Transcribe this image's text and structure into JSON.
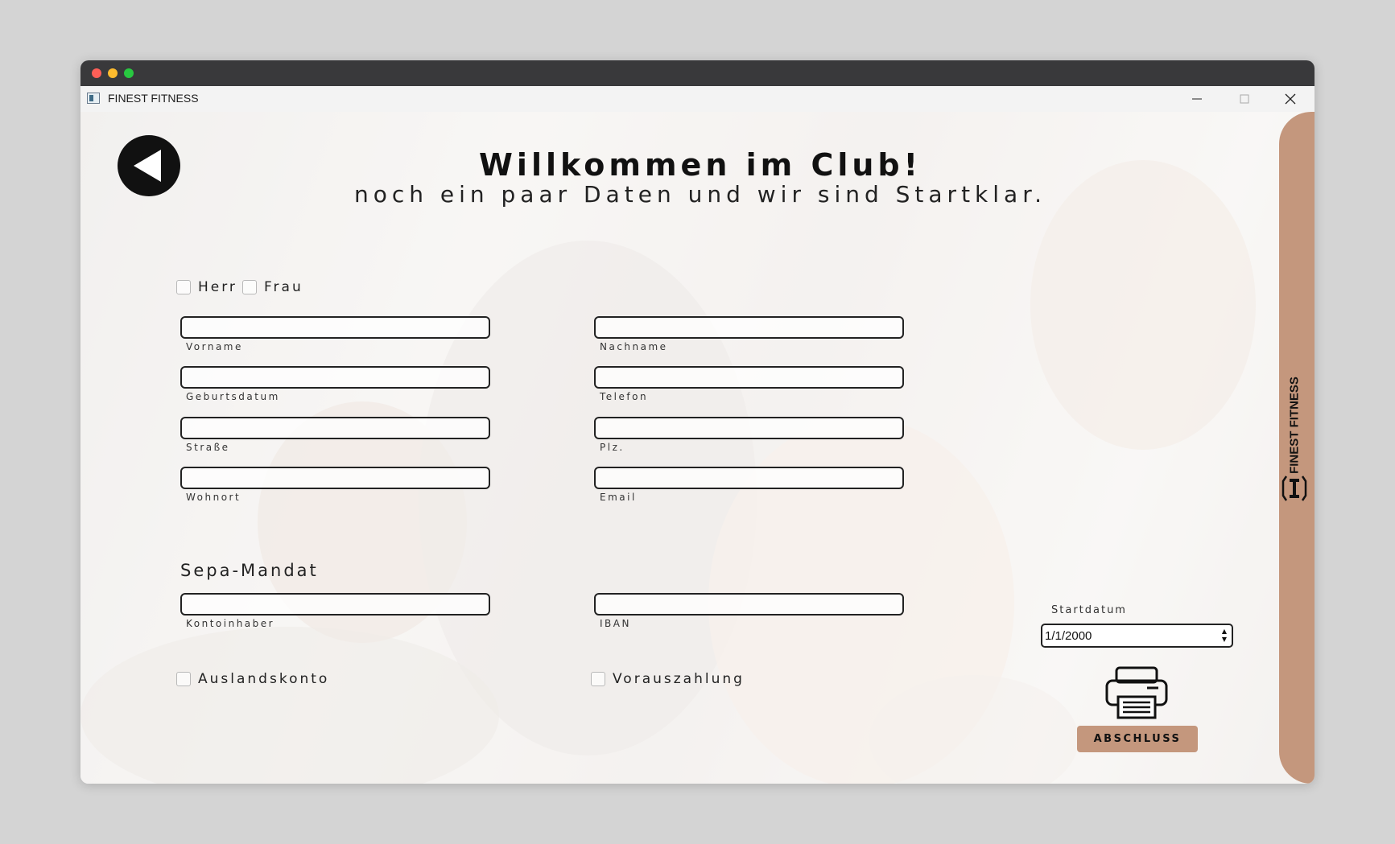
{
  "window": {
    "title": "FINEST FITNESS"
  },
  "header": {
    "title": "Willkommen im Club!",
    "subtitle": "noch ein paar Daten und wir sind Startklar."
  },
  "salutation": {
    "herr": "Herr",
    "frau": "Frau"
  },
  "personal": {
    "vorname": {
      "label": "Vorname",
      "value": ""
    },
    "nachname": {
      "label": "Nachname",
      "value": ""
    },
    "geburtsdatum": {
      "label": "Geburtsdatum",
      "value": ""
    },
    "telefon": {
      "label": "Telefon",
      "value": ""
    },
    "strasse": {
      "label": "Straße",
      "value": ""
    },
    "plz": {
      "label": "Plz.",
      "value": ""
    },
    "wohnort": {
      "label": "Wohnort",
      "value": ""
    },
    "email": {
      "label": "Email",
      "value": ""
    }
  },
  "sepa": {
    "heading": "Sepa-Mandat",
    "kontoinhaber": {
      "label": "Kontoinhaber",
      "value": ""
    },
    "iban": {
      "label": "IBAN",
      "value": ""
    },
    "auslandskonto": "Auslandskonto",
    "vorauszahlung": "Vorauszahlung"
  },
  "startdatum": {
    "label": "Startdatum",
    "value": "1/1/2000"
  },
  "actions": {
    "abschluss": "ABSCHLUSS"
  },
  "side": {
    "brand": "FINEST FITNESS"
  },
  "icons": {
    "back": "back-arrow-icon",
    "printer": "printer-icon",
    "logo": "dumbbell-logo-icon"
  },
  "colors": {
    "accent": "#c4977d",
    "dark": "#111111"
  }
}
